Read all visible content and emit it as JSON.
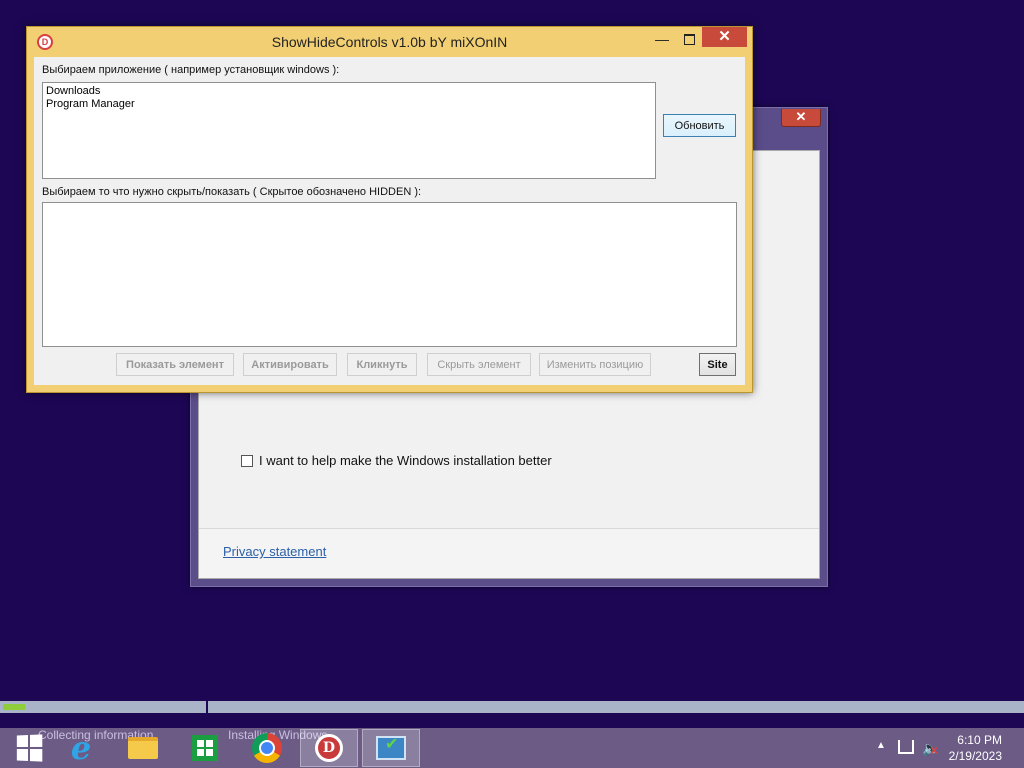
{
  "setup_window": {
    "close_glyph": "✕",
    "checkbox_label": "I want to help make the Windows installation better",
    "checkbox_checked": false,
    "privacy_link": "Privacy statement"
  },
  "shc_window": {
    "title": "ShowHideControls v1.0b bY miXOnIN",
    "app_icon_letter": "D",
    "minimize_glyph": "—",
    "close_glyph": "✕",
    "apps_label": "Выбираем приложение ( например установщик windows ):",
    "apps_list": [
      "Downloads",
      "Program Manager"
    ],
    "refresh_button": "Обновить",
    "controls_label": "Выбираем то что нужно скрыть/показать ( Скрытое обозначено HIDDEN  ):",
    "controls_list": [],
    "buttons": {
      "show": "Показать элемент",
      "activate": "Активировать",
      "click": "Кликнуть",
      "hide": "Скрыть элемент",
      "move": "Изменить позицию",
      "site": "Site"
    }
  },
  "progress": {
    "collecting_fraction": 0.11,
    "stage1_label": "Collecting information",
    "stage2_label": "Installing Windows"
  },
  "taskbar": {
    "apps": [
      "start",
      "internet-explorer",
      "file-explorer",
      "store",
      "chrome",
      "showhidecontrols",
      "windows-setup"
    ],
    "clock_time": "6:10 PM",
    "clock_date": "2/19/2023",
    "colors": {
      "background": "#6b5b85",
      "desktop": "#1d0755",
      "accent_window": "#f2cf72"
    }
  }
}
